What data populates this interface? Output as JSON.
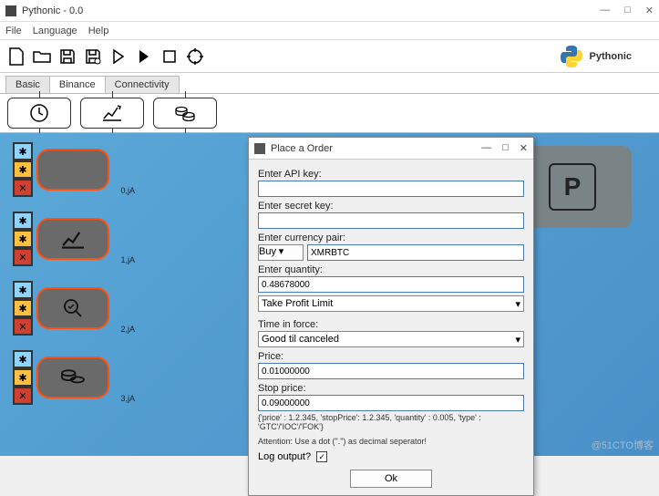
{
  "window": {
    "title": "Pythonic - 0.0",
    "min": "—",
    "max": "□",
    "close": "✕"
  },
  "menu": {
    "file": "File",
    "language": "Language",
    "help": "Help"
  },
  "brand": "Pythonic",
  "tabs": {
    "items": [
      {
        "label": "Basic"
      },
      {
        "label": "Binance"
      },
      {
        "label": "Connectivity"
      }
    ],
    "active": 1
  },
  "palette": {
    "clock": "clock-icon",
    "chart": "chart-icon",
    "coins": "coins-icon"
  },
  "nodes": [
    {
      "label": "0,jA",
      "icon": ""
    },
    {
      "label": "1,jA",
      "icon": "chart"
    },
    {
      "label": "2,jA",
      "icon": "magnify"
    },
    {
      "label": "3,jA",
      "icon": "coins"
    }
  ],
  "park": "P",
  "dialog": {
    "title": "Place a Order",
    "min": "—",
    "max": "□",
    "close": "✕",
    "api_label": "Enter API key:",
    "api_value": "",
    "secret_label": "Enter secret key:",
    "secret_value": "",
    "pair_label": "Enter currency pair:",
    "side": "Buy",
    "side_arrow": "▾",
    "pair_value": "XMRBTC",
    "qty_label": "Enter quantity:",
    "qty_value": "0.48678000",
    "order_type": "Take Profit Limit",
    "type_arrow": "▾",
    "tif_label": "Time in force:",
    "tif_value": "Good til canceled",
    "tif_arrow": "▾",
    "price_label": "Price:",
    "price_value": "0.01000000",
    "stop_label": "Stop price:",
    "stop_value": "0.09000000",
    "example": "{'price' : 1.2.345, 'stopPrice': 1.2.345, 'quantity' : 0.005, 'type' : 'GTC'/'IOC'/'FOK'}",
    "attention": "Attention: Use a dot (\".\") as decimal seperator!",
    "log_label": "Log output?",
    "log_check": "✓",
    "ok": "Ok"
  },
  "watermark": "@51CTO博客"
}
